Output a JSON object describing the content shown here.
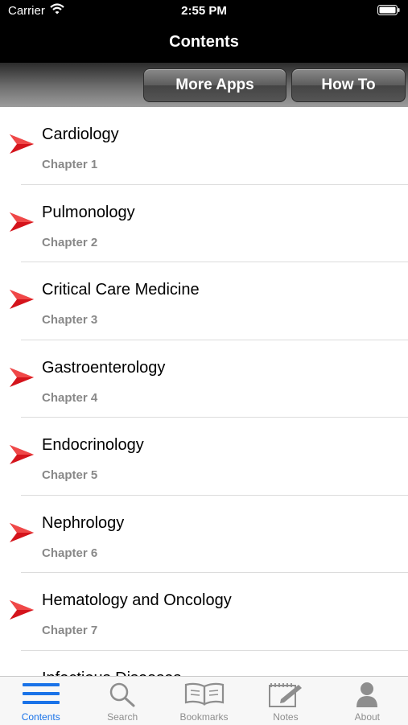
{
  "status": {
    "carrier": "Carrier",
    "time": "2:55 PM"
  },
  "nav": {
    "title": "Contents"
  },
  "toolbar": {
    "more_apps": "More Apps",
    "how_to": "How To"
  },
  "chapters": [
    {
      "title": "Cardiology",
      "subtitle": "Chapter 1"
    },
    {
      "title": "Pulmonology",
      "subtitle": "Chapter 2"
    },
    {
      "title": "Critical Care Medicine",
      "subtitle": "Chapter 3"
    },
    {
      "title": "Gastroenterology",
      "subtitle": "Chapter 4"
    },
    {
      "title": "Endocrinology",
      "subtitle": "Chapter 5"
    },
    {
      "title": "Nephrology",
      "subtitle": "Chapter 6"
    },
    {
      "title": "Hematology and Oncology",
      "subtitle": "Chapter 7"
    },
    {
      "title": "Infectious Diseases",
      "subtitle": ""
    }
  ],
  "tabs": [
    {
      "label": "Contents",
      "icon": "list-icon",
      "active": true
    },
    {
      "label": "Search",
      "icon": "magnifier-icon",
      "active": false
    },
    {
      "label": "Bookmarks",
      "icon": "book-icon",
      "active": false
    },
    {
      "label": "Notes",
      "icon": "notepad-icon",
      "active": false
    },
    {
      "label": "About",
      "icon": "person-icon",
      "active": false
    }
  ],
  "colors": {
    "accent": "#1a73e8",
    "arrow": "#d4141c",
    "bar": "#000000"
  }
}
